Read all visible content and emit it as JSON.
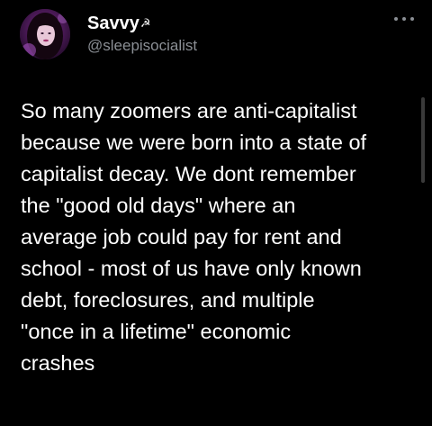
{
  "author": {
    "display_name": "Savvy",
    "name_icon": "hammer-and-sickle-icon",
    "name_icon_glyph": "☭",
    "handle": "@sleepisocialist"
  },
  "more_menu": {
    "icon": "more-horizontal-icon"
  },
  "tweet": {
    "lines": [
      "So many zoomers are anti-capitalist",
      "because we were born into a state of",
      "capitalist decay. We dont remember",
      "the \"good old days\" where an",
      "average job could pay for rent and",
      "school - most of us have only known",
      "debt, foreclosures, and multiple",
      "\"once in a lifetime\" economic",
      "crashes"
    ]
  },
  "colors": {
    "background": "#000000",
    "text": "#ffffff",
    "secondary_text": "#8b8f95",
    "avatar_accent": "#b04ac8"
  }
}
